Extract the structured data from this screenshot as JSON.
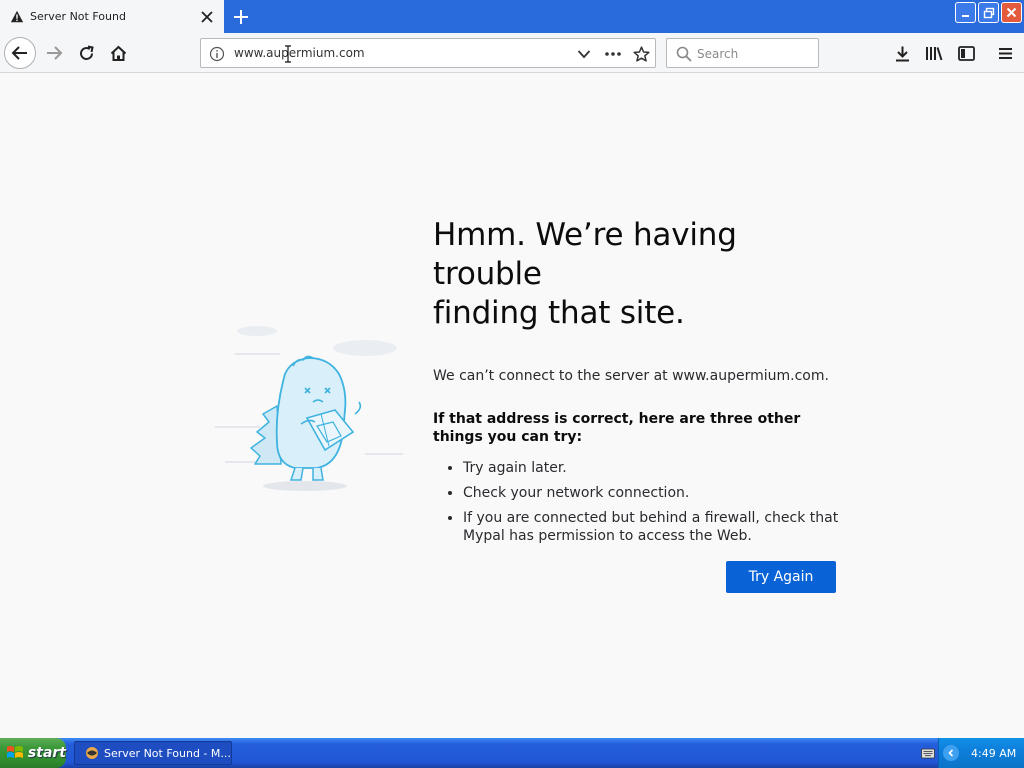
{
  "tab": {
    "title": "Server Not Found"
  },
  "navbar": {
    "url": "www.aupermium.com",
    "search_placeholder": "Search"
  },
  "error": {
    "title_line1": "Hmm. We’re having trouble",
    "title_line2": "finding that site.",
    "description": "We can’t connect to the server at www.aupermium.com.",
    "hint": "If that address is correct, here are three other things you can try:",
    "suggestions": [
      "Try again later.",
      "Check your network connection.",
      "If you are connected but behind a firewall, check that Mypal has permission to access the Web."
    ],
    "button_label": "Try Again"
  },
  "taskbar": {
    "start_label": "start",
    "window_item": "Server Not Found - M...",
    "clock": "4:49 AM"
  },
  "colors": {
    "tabstrip": "#2a6bdc",
    "button": "#0a63d6",
    "taskbar": "#245edb",
    "start": "#3c9a3a"
  },
  "icons": [
    "warning-icon",
    "close-icon",
    "plus-icon",
    "back-icon",
    "forward-icon",
    "reload-icon",
    "home-icon",
    "info-icon",
    "dropdown-icon",
    "more-icon",
    "star-icon",
    "search-icon",
    "download-icon",
    "library-icon",
    "sidebar-icon",
    "menu-icon",
    "windows-logo-icon",
    "keyboard-icon"
  ]
}
